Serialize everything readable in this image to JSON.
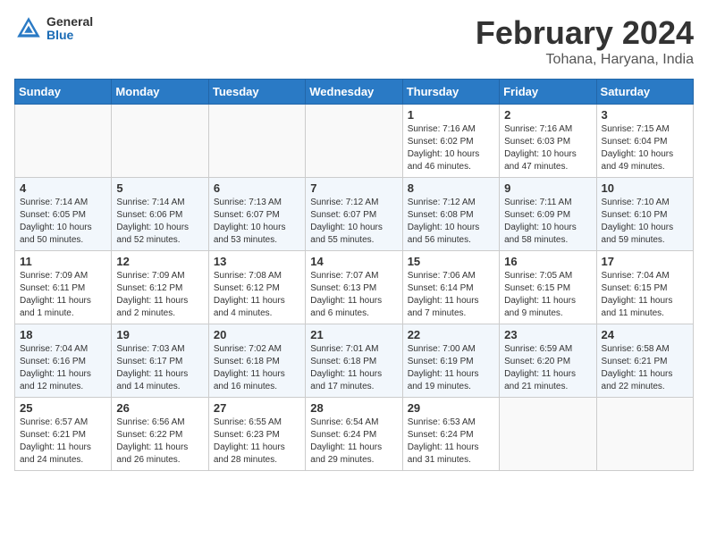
{
  "header": {
    "logo_general": "General",
    "logo_blue": "Blue",
    "month_title": "February 2024",
    "location": "Tohana, Haryana, India"
  },
  "days_of_week": [
    "Sunday",
    "Monday",
    "Tuesday",
    "Wednesday",
    "Thursday",
    "Friday",
    "Saturday"
  ],
  "weeks": [
    [
      {
        "day": "",
        "info": ""
      },
      {
        "day": "",
        "info": ""
      },
      {
        "day": "",
        "info": ""
      },
      {
        "day": "",
        "info": ""
      },
      {
        "day": "1",
        "info": "Sunrise: 7:16 AM\nSunset: 6:02 PM\nDaylight: 10 hours and 46 minutes."
      },
      {
        "day": "2",
        "info": "Sunrise: 7:16 AM\nSunset: 6:03 PM\nDaylight: 10 hours and 47 minutes."
      },
      {
        "day": "3",
        "info": "Sunrise: 7:15 AM\nSunset: 6:04 PM\nDaylight: 10 hours and 49 minutes."
      }
    ],
    [
      {
        "day": "4",
        "info": "Sunrise: 7:14 AM\nSunset: 6:05 PM\nDaylight: 10 hours and 50 minutes."
      },
      {
        "day": "5",
        "info": "Sunrise: 7:14 AM\nSunset: 6:06 PM\nDaylight: 10 hours and 52 minutes."
      },
      {
        "day": "6",
        "info": "Sunrise: 7:13 AM\nSunset: 6:07 PM\nDaylight: 10 hours and 53 minutes."
      },
      {
        "day": "7",
        "info": "Sunrise: 7:12 AM\nSunset: 6:07 PM\nDaylight: 10 hours and 55 minutes."
      },
      {
        "day": "8",
        "info": "Sunrise: 7:12 AM\nSunset: 6:08 PM\nDaylight: 10 hours and 56 minutes."
      },
      {
        "day": "9",
        "info": "Sunrise: 7:11 AM\nSunset: 6:09 PM\nDaylight: 10 hours and 58 minutes."
      },
      {
        "day": "10",
        "info": "Sunrise: 7:10 AM\nSunset: 6:10 PM\nDaylight: 10 hours and 59 minutes."
      }
    ],
    [
      {
        "day": "11",
        "info": "Sunrise: 7:09 AM\nSunset: 6:11 PM\nDaylight: 11 hours and 1 minute."
      },
      {
        "day": "12",
        "info": "Sunrise: 7:09 AM\nSunset: 6:12 PM\nDaylight: 11 hours and 2 minutes."
      },
      {
        "day": "13",
        "info": "Sunrise: 7:08 AM\nSunset: 6:12 PM\nDaylight: 11 hours and 4 minutes."
      },
      {
        "day": "14",
        "info": "Sunrise: 7:07 AM\nSunset: 6:13 PM\nDaylight: 11 hours and 6 minutes."
      },
      {
        "day": "15",
        "info": "Sunrise: 7:06 AM\nSunset: 6:14 PM\nDaylight: 11 hours and 7 minutes."
      },
      {
        "day": "16",
        "info": "Sunrise: 7:05 AM\nSunset: 6:15 PM\nDaylight: 11 hours and 9 minutes."
      },
      {
        "day": "17",
        "info": "Sunrise: 7:04 AM\nSunset: 6:15 PM\nDaylight: 11 hours and 11 minutes."
      }
    ],
    [
      {
        "day": "18",
        "info": "Sunrise: 7:04 AM\nSunset: 6:16 PM\nDaylight: 11 hours and 12 minutes."
      },
      {
        "day": "19",
        "info": "Sunrise: 7:03 AM\nSunset: 6:17 PM\nDaylight: 11 hours and 14 minutes."
      },
      {
        "day": "20",
        "info": "Sunrise: 7:02 AM\nSunset: 6:18 PM\nDaylight: 11 hours and 16 minutes."
      },
      {
        "day": "21",
        "info": "Sunrise: 7:01 AM\nSunset: 6:18 PM\nDaylight: 11 hours and 17 minutes."
      },
      {
        "day": "22",
        "info": "Sunrise: 7:00 AM\nSunset: 6:19 PM\nDaylight: 11 hours and 19 minutes."
      },
      {
        "day": "23",
        "info": "Sunrise: 6:59 AM\nSunset: 6:20 PM\nDaylight: 11 hours and 21 minutes."
      },
      {
        "day": "24",
        "info": "Sunrise: 6:58 AM\nSunset: 6:21 PM\nDaylight: 11 hours and 22 minutes."
      }
    ],
    [
      {
        "day": "25",
        "info": "Sunrise: 6:57 AM\nSunset: 6:21 PM\nDaylight: 11 hours and 24 minutes."
      },
      {
        "day": "26",
        "info": "Sunrise: 6:56 AM\nSunset: 6:22 PM\nDaylight: 11 hours and 26 minutes."
      },
      {
        "day": "27",
        "info": "Sunrise: 6:55 AM\nSunset: 6:23 PM\nDaylight: 11 hours and 28 minutes."
      },
      {
        "day": "28",
        "info": "Sunrise: 6:54 AM\nSunset: 6:24 PM\nDaylight: 11 hours and 29 minutes."
      },
      {
        "day": "29",
        "info": "Sunrise: 6:53 AM\nSunset: 6:24 PM\nDaylight: 11 hours and 31 minutes."
      },
      {
        "day": "",
        "info": ""
      },
      {
        "day": "",
        "info": ""
      }
    ]
  ]
}
